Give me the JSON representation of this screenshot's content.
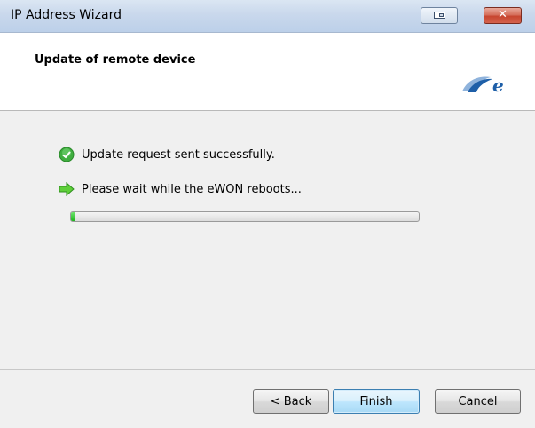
{
  "window": {
    "title": "IP Address Wizard"
  },
  "header": {
    "title": "Update of remote device"
  },
  "status": [
    {
      "icon": "check-circle-icon",
      "text": "Update request sent successfully."
    },
    {
      "icon": "green-arrow-icon",
      "text": "Please wait while the eWON reboots..."
    }
  ],
  "progress": {
    "percent": 1
  },
  "buttons": {
    "back": "< Back",
    "finish": "Finish",
    "cancel": "Cancel"
  },
  "colors": {
    "accent": "#1fb51f",
    "brand": "#1e5fa8"
  }
}
